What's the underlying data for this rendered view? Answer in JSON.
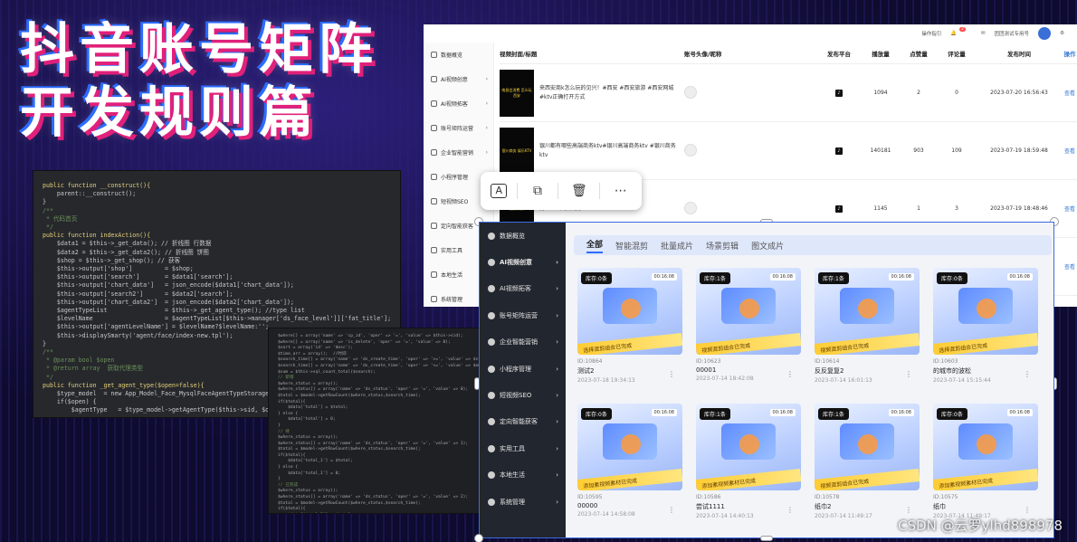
{
  "headline": {
    "line1": "抖音账号矩阵",
    "line2": "开发规则篇"
  },
  "code1": [
    "public function __construct(){",
    "    parent::__construct();",
    "}",
    "/**",
    " * 代码首页",
    " */",
    "public function indexAction(){",
    "    $data1 = $this->_get_data(); // 折线图 行数据",
    "    $data2 = $this->_get_data2(); // 折线图 饼图",
    "    $shop = $this->_get_shop(); // 获客",
    "    $this->output['shop']         = $shop;",
    "    $this->output['search']       = $data1['search'];",
    "    $this->output['chart_data']   = json_encode($data1['chart_data']);",
    "    $this->output['search2']      = $data2['search'];",
    "    $this->output['chart_data2']  = json_encode($data2['chart_data']);",
    "    $agentTypeList                = $this->_get_agent_type(); //type list",
    "    $levelName                    = $agentTypeList[$this->manager['ds_face_level']]['fat_title'];",
    "    $this->output['agentLevelName'] = $levelName?$levelName:'';",
    "    $this->displaySmarty('agent/face/index-new.tpl');",
    "}",
    "",
    "/**",
    " * @param bool $open",
    " * @return array  获取代理类型",
    " */",
    "public function _get_agent_type($open=false){",
    "    $type_model  = new App_Model_Face_MysqlFaceAgentTypeStorage();",
    "    if($open) {",
    "        $agentType   = $type_model->getAgentType($this->sid, $open);"
  ],
  "code2": [
    "$where[] = array('name' => 'cp_id', 'oper' => '=', 'value' => $this->sid);",
    "$where[] = array('name' => 'is_delete', 'oper' => '=', 'value' => 0);",
    "$sort = array('id' => 'desc');",
    "",
    "$time_arr = array();  //时间",
    "$search_time[] = array('name' => 'ds_create_time', 'oper' => '>=', 'value' => $start);",
    "$search_time[] = array('name' => 'ds_create_time', 'oper' => '<=', 'value' => $end);",
    "$sum = $this->sql_count_total($search);",
    "",
    "// 新增",
    "$where_status = array();",
    "$where_status[] = array('name' => 'ds_status', 'oper' => '=', 'value' => 0);",
    "$total = $model->getRowCount($where_status,$search_time);",
    "if($total){",
    "    $data['total'] = $total;",
    "} else {",
    "    $data['total'] = 0;",
    "}",
    "",
    "// 待",
    "$where_status = array();",
    "$where_status[] = array('name' => 'ds_status', 'oper' => '=', 'value' => 1);",
    "$total = $model->getRowCount($where_status,$search_time);",
    "if($total){",
    "    $data['total_1'] = $total;",
    "} else {",
    "    $data['total_1'] = 0;",
    "}",
    "",
    "// 已完成",
    "$where_status = array();",
    "$where_status[] = array('name' => 'ds_status', 'oper' => '=', 'value' => 2);",
    "$total = $model->getRowCount($where_status,$search_time);",
    "if($total){",
    "    $data['total_2'] = $total;",
    "} else {",
    "    $data['total_2'] = 0;",
    "}"
  ],
  "admin": {
    "topbar": {
      "operator": "操作指引",
      "badge": "2",
      "user": "团团测试专用号"
    },
    "sidebar": [
      {
        "label": "数据概览",
        "chev": ""
      },
      {
        "label": "AI视频创意",
        "chev": "›"
      },
      {
        "label": "AI视频拓客",
        "chev": "›"
      },
      {
        "label": "账号矩阵运营",
        "chev": "›"
      },
      {
        "label": "企业智能营销",
        "chev": "›"
      },
      {
        "label": "小程序管理",
        "chev": ""
      },
      {
        "label": "短视频SEO",
        "chev": ""
      },
      {
        "label": "定向智能获客",
        "chev": ""
      },
      {
        "label": "实用工具",
        "chev": ""
      },
      {
        "label": "本地生活",
        "chev": ""
      },
      {
        "label": "系统管理",
        "chev": ""
      }
    ],
    "columns": [
      "视频封面/标题",
      "账号头像/昵称",
      "发布平台",
      "播放量",
      "点赞量",
      "评论量",
      "发布时间",
      "操作"
    ],
    "rows": [
      {
        "thumb": "南昌会消费\n怎么玩西安",
        "title": "来西安商k怎么玩的见兴！#西安 #西安旅游 #西安网城 #ktv正确打开方式",
        "platform": "♪",
        "plays": "1094",
        "likes": "2",
        "comments": "0",
        "time": "2023-07-20 16:56:43",
        "action": "查看"
      },
      {
        "thumb": "银川商务\n娱乐KTV",
        "title": "银川都有哪些高端商务ktv#银川高端商务ktv #银川商务ktv",
        "platform": "♪",
        "plays": "140181",
        "likes": "903",
        "comments": "109",
        "time": "2023-07-19 18:59:48",
        "action": "查看"
      },
      {
        "thumb": "西安商务",
        "title": "务ktv #西安商务ktv",
        "platform": "♪",
        "plays": "1145",
        "likes": "1",
        "comments": "3",
        "time": "2023-07-19 18:48:46",
        "action": "查看"
      },
      {
        "thumb": "",
        "title": "",
        "platform": "",
        "plays": "",
        "likes": "",
        "comments": "",
        "time": "",
        "action": "查看"
      }
    ]
  },
  "toolbar": {
    "ai": "A",
    "copy": "⧉",
    "delete": "🗑",
    "more": "⋯"
  },
  "app": {
    "sidebar": [
      {
        "label": "数据概览",
        "chev": "",
        "bold": false
      },
      {
        "label": "AI视频创意",
        "chev": "›",
        "bold": true
      },
      {
        "label": "AI视频拓客",
        "chev": "›",
        "bold": false
      },
      {
        "label": "账号矩阵运营",
        "chev": "›",
        "bold": false
      },
      {
        "label": "企业智能营销",
        "chev": "›",
        "bold": false
      },
      {
        "label": "小程序管理",
        "chev": "›",
        "bold": false
      },
      {
        "label": "短视频SEO",
        "chev": "›",
        "bold": false
      },
      {
        "label": "定向智能获客",
        "chev": "›",
        "bold": false
      },
      {
        "label": "实用工具",
        "chev": "›",
        "bold": false
      },
      {
        "label": "本地生活",
        "chev": "›",
        "bold": false
      },
      {
        "label": "系统管理",
        "chev": "›",
        "bold": false
      }
    ],
    "tabs": [
      "全部",
      "智能混剪",
      "批量成片",
      "场景剪辑",
      "图文成片"
    ],
    "cards": [
      {
        "tag": "库存:0条",
        "ts": "00:16:08",
        "banner": "选择混剪组合已完成",
        "id": "ID:10864",
        "name": "测试2",
        "date": "2023-07-18 19:34:13"
      },
      {
        "tag": "库存:1条",
        "ts": "00:16:08",
        "banner": "视频混剪组合已完成",
        "id": "ID:10623",
        "name": "00001",
        "date": "2023-07-14 18:42:08"
      },
      {
        "tag": "库存:1条",
        "ts": "00:16:08",
        "banner": "视频混剪组合已完成",
        "id": "ID:10614",
        "name": "反反复复2",
        "date": "2023-07-14 16:01:13"
      },
      {
        "tag": "库存:0条",
        "ts": "00:16:08",
        "banner": "选择混剪组合已完成",
        "id": "ID:10603",
        "name": "的城市的波松",
        "date": "2023-07-14 15:15:44"
      },
      {
        "tag": "库存:0条",
        "ts": "00:16:08",
        "banner": "添加素视频素材已完成",
        "id": "ID:10595",
        "name": "00000",
        "date": "2023-07-14 14:58:08"
      },
      {
        "tag": "库存:1条",
        "ts": "00:16:08",
        "banner": "添加素视频素材已完成",
        "id": "ID:10586",
        "name": "尝试1111",
        "date": "2023-07-14 14:40:13"
      },
      {
        "tag": "库存:1条",
        "ts": "00:16:08",
        "banner": "视频混剪组合已完成",
        "id": "ID:10578",
        "name": "纸巾2",
        "date": "2023-07-14 11:49:17"
      },
      {
        "tag": "库存:0条",
        "ts": "00:16:08",
        "banner": "添加素视频素材已完成",
        "id": "ID:10575",
        "name": "纸巾",
        "date": "2023-07-14 11:49:17"
      }
    ]
  },
  "watermark": "CSDN @云罗ylhd898978"
}
